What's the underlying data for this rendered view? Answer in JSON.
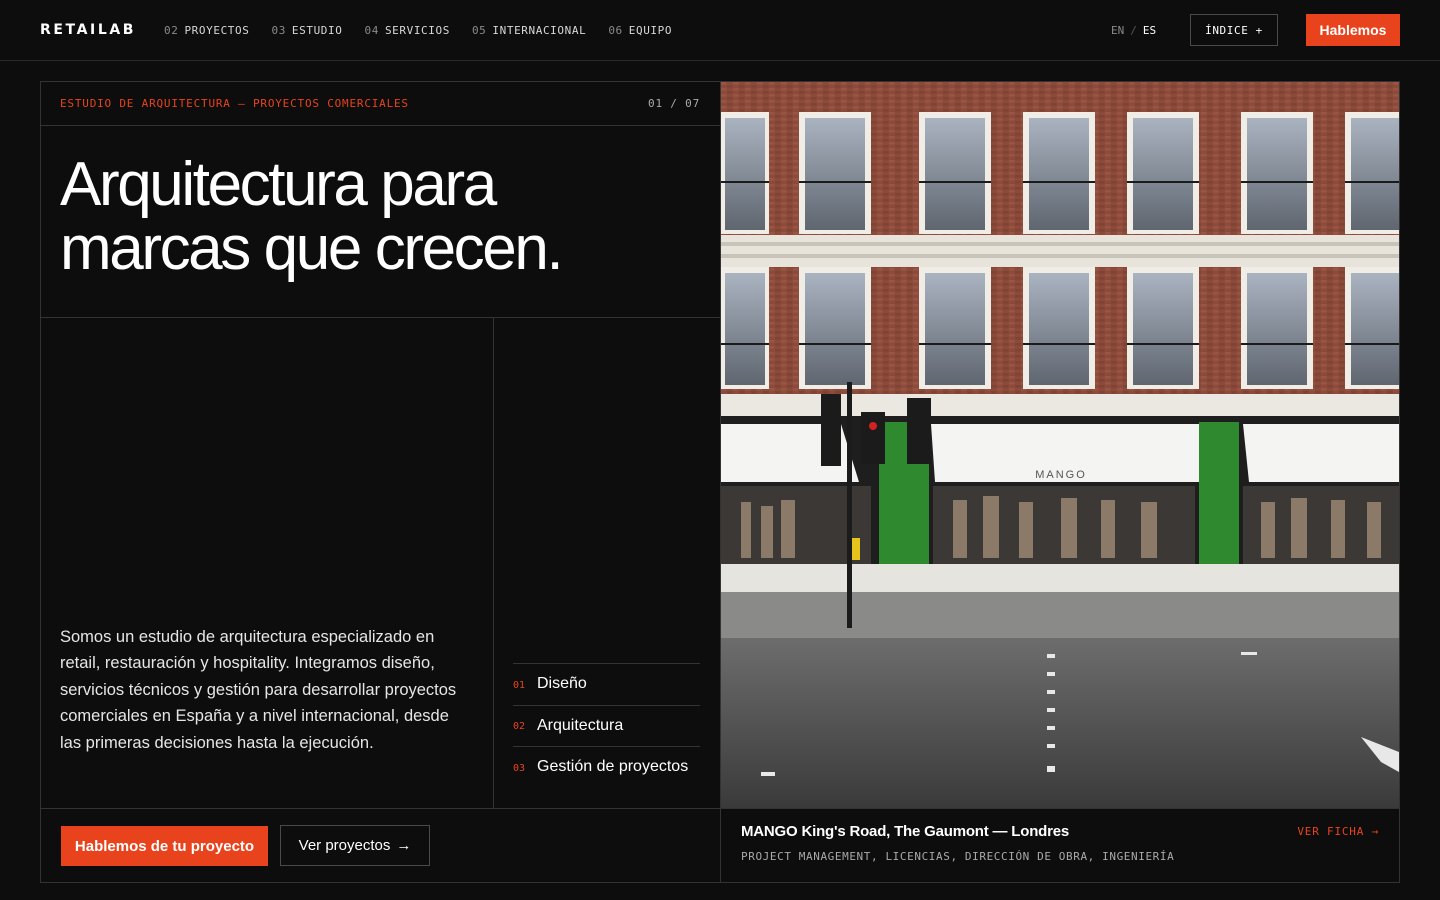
{
  "nav": {
    "logo": "RETAILAB",
    "items": [
      {
        "num": "02",
        "label": "PROYECTOS"
      },
      {
        "num": "03",
        "label": "ESTUDIO"
      },
      {
        "num": "04",
        "label": "SERVICIOS"
      },
      {
        "num": "05",
        "label": "INTERNACIONAL"
      },
      {
        "num": "06",
        "label": "EQUIPO"
      }
    ],
    "lang": {
      "en": "EN",
      "sep": "/",
      "es": "ES"
    },
    "index_label": "ÍNDICE +",
    "cta_label": "Hablemos"
  },
  "hero": {
    "eyebrow": "ESTUDIO DE ARQUITECTURA — PROYECTOS COMERCIALES",
    "counter": "01 / 07",
    "title_line1": "Arquitectura para",
    "title_line2": "marcas que crecen.",
    "description": "Somos un estudio de arquitectura especializado en retail, restauración y hospitality. Integramos diseño, servicios técnicos y gestión para desarrollar proyectos comerciales en España y a nivel internacional, desde las primeras decisiones hasta la ejecución.",
    "services": [
      {
        "num": "01",
        "label": "Diseño"
      },
      {
        "num": "02",
        "label": "Arquitectura"
      },
      {
        "num": "03",
        "label": "Gestión de proyectos"
      }
    ],
    "primary_button": "Hablemos de tu proyecto",
    "secondary_button": "Ver proyectos",
    "secondary_arrow": "→"
  },
  "featured": {
    "sign_text": "MANGO",
    "title": "MANGO King's Road, The Gaumont — Londres",
    "subtitle": "PROJECT MANAGEMENT, LICENCIAS, DIRECCIÓN DE OBRA, INGENIERÍA",
    "link": "VER FICHA →"
  },
  "colors": {
    "accent": "#e8431c",
    "background": "#0d0d0d",
    "border": "#333333"
  }
}
